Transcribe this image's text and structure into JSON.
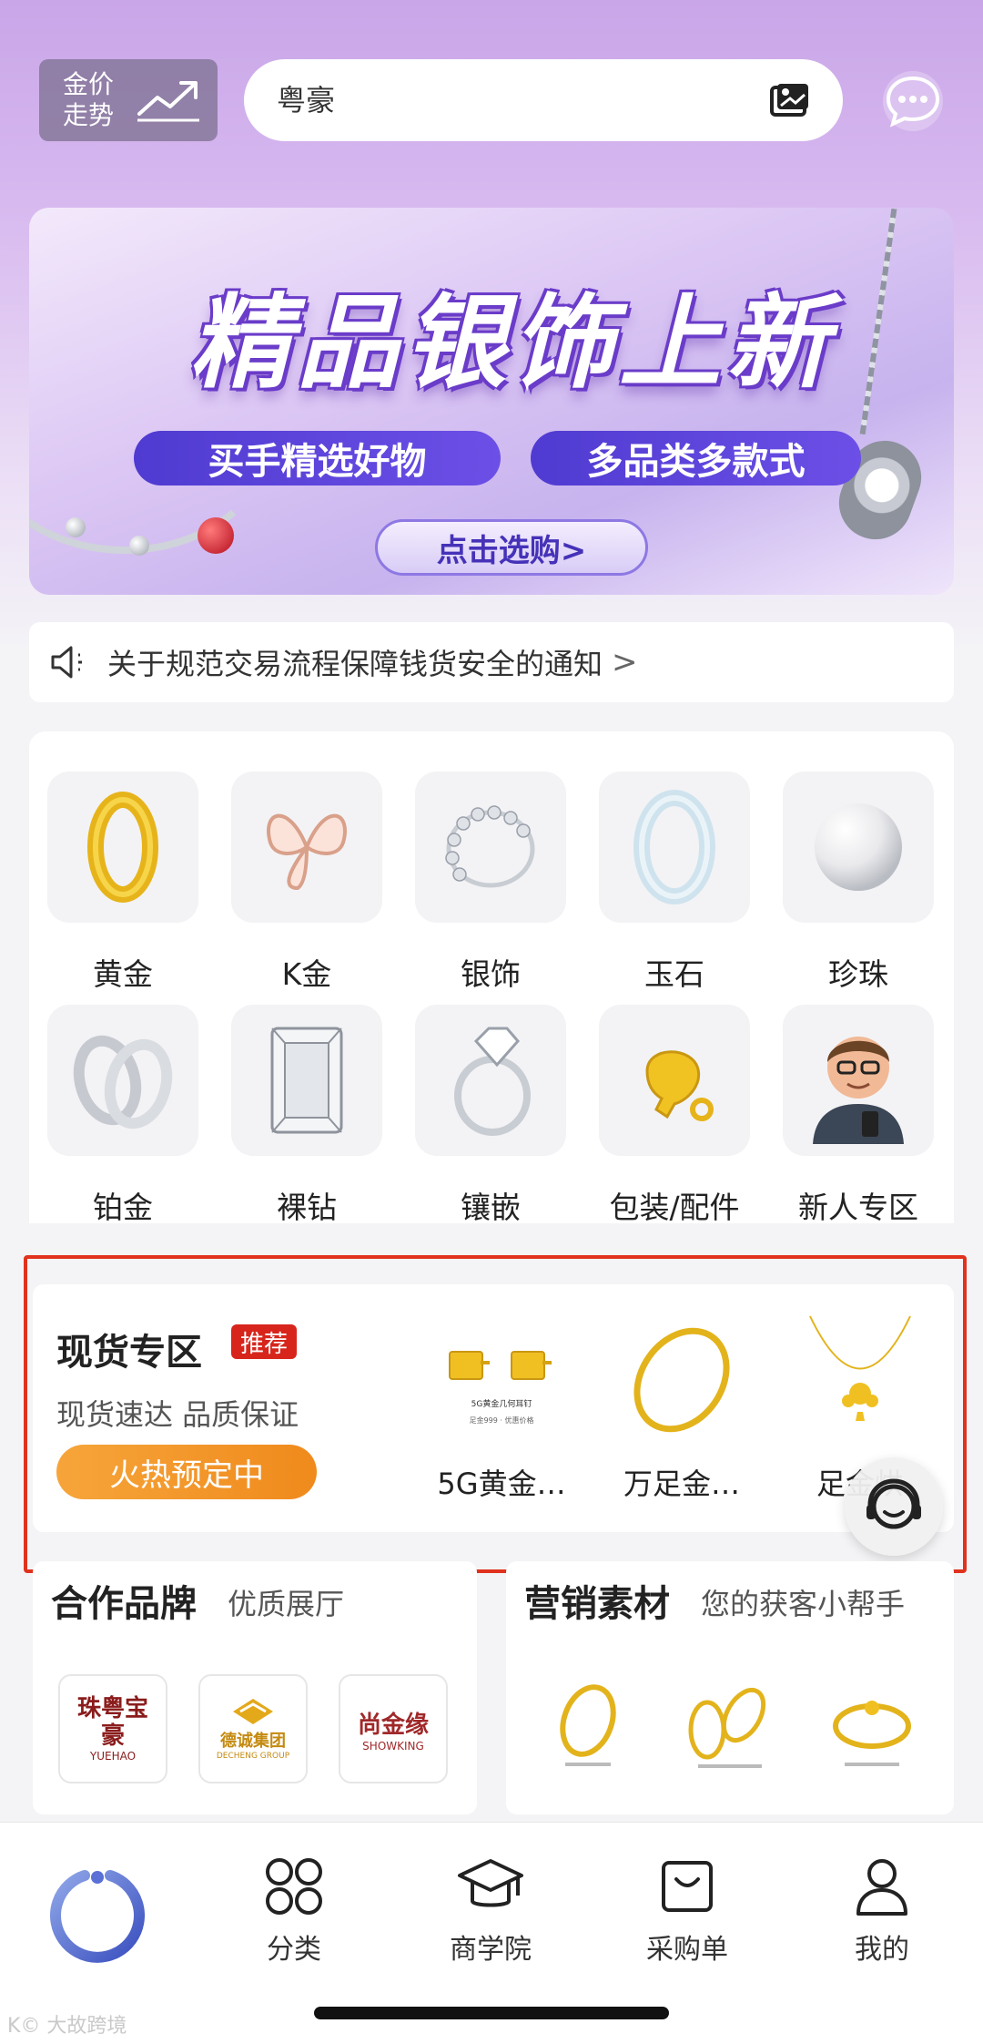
{
  "header": {
    "gold_trend_label": "金价走势",
    "search_placeholder": "粤豪"
  },
  "banner": {
    "title": "精品银饰上新",
    "pill_left": "买手精选好物",
    "pill_right": "多品类多款式",
    "cta": "点击选购>"
  },
  "notice": {
    "text": "关于规范交易流程保障钱货安全的通知",
    "chevron": ">"
  },
  "categories": [
    {
      "label": "黄金",
      "icon": "gold-ring-icon"
    },
    {
      "label": "K金",
      "icon": "butterfly-pendant-icon"
    },
    {
      "label": "银饰",
      "icon": "silver-ring-icon"
    },
    {
      "label": "玉石",
      "icon": "jade-bangle-icon"
    },
    {
      "label": "珍珠",
      "icon": "pearl-icon"
    },
    {
      "label": "铂金",
      "icon": "platinum-rings-icon"
    },
    {
      "label": "裸钻",
      "icon": "diamond-icon"
    },
    {
      "label": "镶嵌",
      "icon": "solitaire-ring-icon"
    },
    {
      "label": "包装/配件",
      "icon": "clasp-icon"
    },
    {
      "label": "新人专区",
      "icon": "newcomer-avatar-icon"
    }
  ],
  "featured": {
    "title": "现货专区",
    "badge": "推荐",
    "subtitle": "现货速达 品质保证",
    "button": "火热预定中",
    "products": [
      {
        "name": "5G黄金…",
        "caption": "5G黄金几何耳钉",
        "caption2": "足金999 · 优惠价格"
      },
      {
        "name": "万足金…"
      },
      {
        "name": "足金烘"
      }
    ]
  },
  "partners": {
    "title": "合作品牌",
    "subtitle": "优质展厅",
    "brands": [
      {
        "name": "珠粤宝豪",
        "en": "YUEHAO"
      },
      {
        "name": "德诚集团",
        "en": "DECHENG GROUP"
      },
      {
        "name": "尚金缘",
        "en": "SHOWKING"
      }
    ]
  },
  "marketing": {
    "title": "营销素材",
    "subtitle": "您的获客小帮手"
  },
  "bottom_nav": [
    {
      "label": "分类",
      "icon": "category-grid-icon"
    },
    {
      "label": "商学院",
      "icon": "graduation-cap-icon"
    },
    {
      "label": "采购单",
      "icon": "shopping-bag-icon"
    },
    {
      "label": "我的",
      "icon": "user-icon"
    }
  ],
  "watermark": "K© 大故跨境",
  "colors": {
    "accent_red": "#d7251c",
    "accent_orange": "#f08a1c",
    "banner_purple": "#5b44d8"
  }
}
